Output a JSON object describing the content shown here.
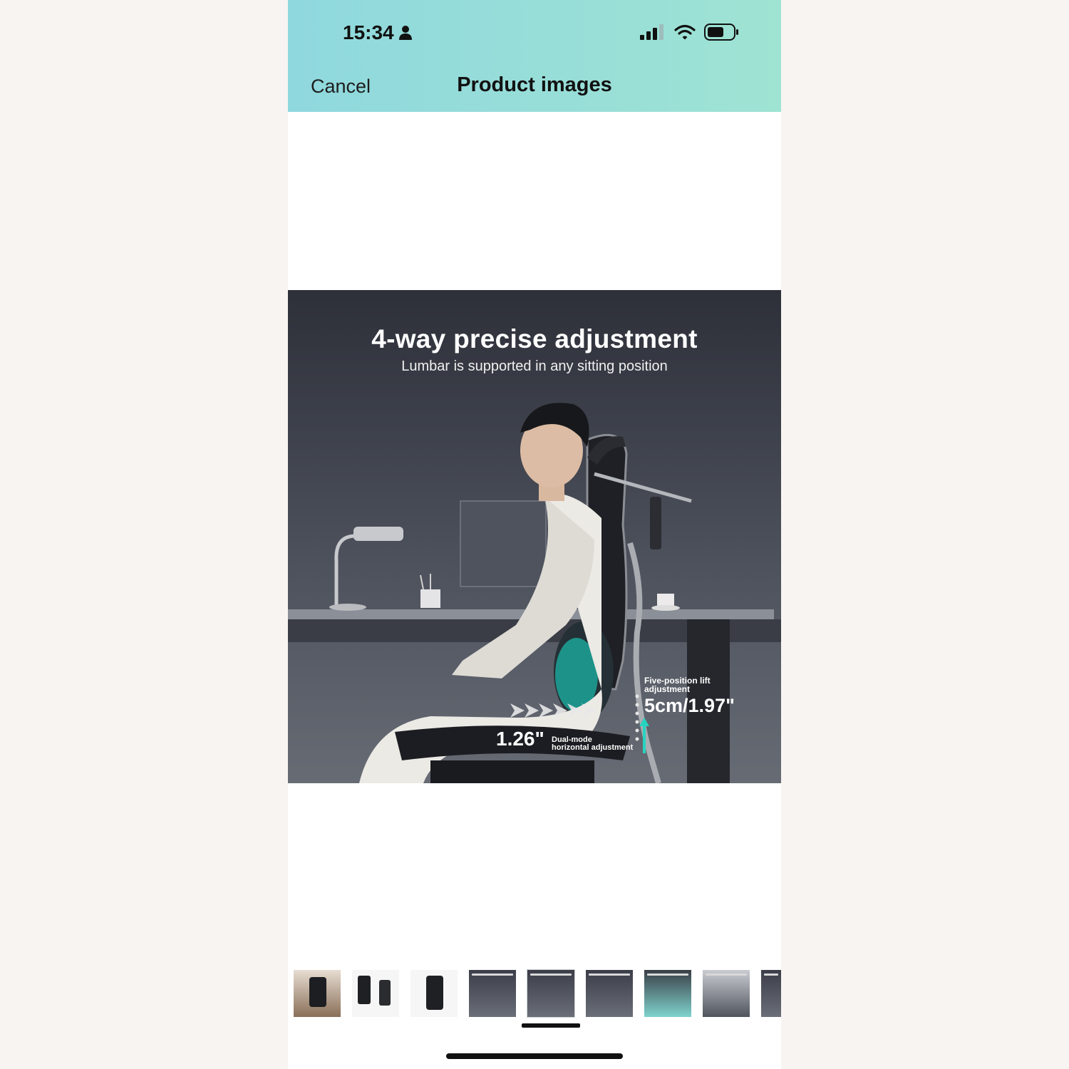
{
  "status_bar": {
    "time": "15:34",
    "icons": [
      "person-icon",
      "signal-icon",
      "wifi-icon",
      "battery-icon"
    ]
  },
  "nav": {
    "cancel_label": "Cancel",
    "title": "Product images"
  },
  "image": {
    "title": "4-way precise adjustment",
    "subtitle": "Lumbar is supported in any sitting position",
    "lift_label_line1": "Five-position lift",
    "lift_label_line2": "adjustment",
    "lift_value": "5cm/1.97\"",
    "horizontal_value": "1.26\"",
    "horizontal_label_line1": "Dual-mode",
    "horizontal_label_line2": "horizontal adjustment"
  },
  "thumbnails": {
    "count": 9,
    "selected_index": 4,
    "items": [
      {
        "name": "thumbnail-1",
        "style": "photo"
      },
      {
        "name": "thumbnail-2",
        "style": "light"
      },
      {
        "name": "thumbnail-3",
        "style": "light"
      },
      {
        "name": "thumbnail-4",
        "style": "dark"
      },
      {
        "name": "thumbnail-5",
        "style": "dark"
      },
      {
        "name": "thumbnail-6",
        "style": "dark"
      },
      {
        "name": "thumbnail-7",
        "style": "dark"
      },
      {
        "name": "thumbnail-8",
        "style": "dark"
      },
      {
        "name": "thumbnail-9",
        "style": "dark"
      }
    ]
  },
  "colors": {
    "header_gradient_start": "#8fd8de",
    "header_gradient_end": "#9fe3d3",
    "accent_teal": "#27d3c0"
  }
}
